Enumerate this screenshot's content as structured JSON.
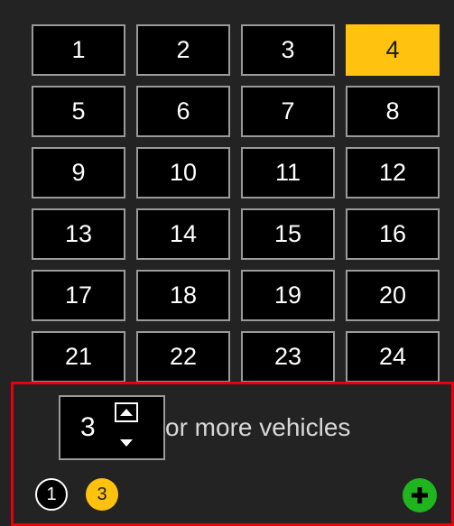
{
  "grid": {
    "items": [
      {
        "label": "1"
      },
      {
        "label": "2"
      },
      {
        "label": "3"
      },
      {
        "label": "4",
        "selected": true
      },
      {
        "label": "5"
      },
      {
        "label": "6"
      },
      {
        "label": "7"
      },
      {
        "label": "8"
      },
      {
        "label": "9"
      },
      {
        "label": "10"
      },
      {
        "label": "11"
      },
      {
        "label": "12"
      },
      {
        "label": "13"
      },
      {
        "label": "14"
      },
      {
        "label": "15"
      },
      {
        "label": "16"
      },
      {
        "label": "17"
      },
      {
        "label": "18"
      },
      {
        "label": "19"
      },
      {
        "label": "20"
      },
      {
        "label": "21"
      },
      {
        "label": "22"
      },
      {
        "label": "23"
      },
      {
        "label": "24"
      }
    ]
  },
  "vehicle_filter": {
    "count": "3",
    "suffix": "or more vehicles"
  },
  "badges": [
    {
      "label": "1",
      "icon": "circle-badge"
    },
    {
      "label": "3",
      "icon": "circle-badge"
    }
  ],
  "icons": {
    "add": "plus-icon",
    "up": "triangle-up-icon",
    "down": "triangle-down-icon"
  },
  "colors": {
    "background": "#232323",
    "selected": "#ffc20e",
    "highlight_border": "#e8000d",
    "add_button": "#1fb51f"
  }
}
